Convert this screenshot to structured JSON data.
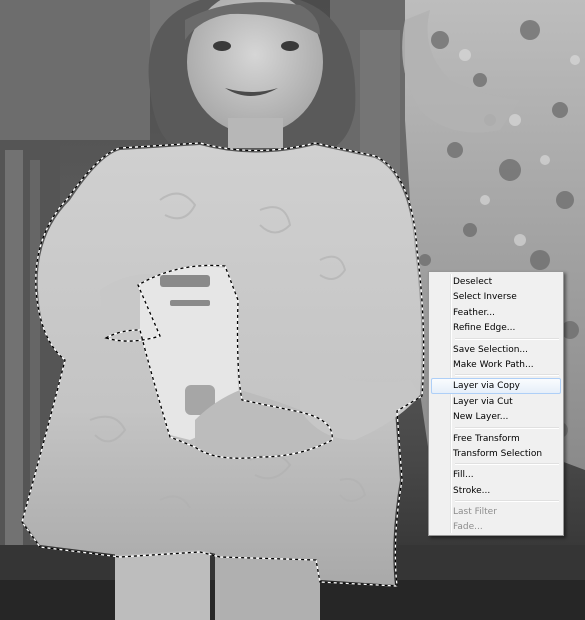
{
  "context_menu": {
    "groups": [
      [
        {
          "label": "Deselect",
          "enabled": true
        },
        {
          "label": "Select Inverse",
          "enabled": true
        },
        {
          "label": "Feather...",
          "enabled": true
        },
        {
          "label": "Refine Edge...",
          "enabled": true
        }
      ],
      [
        {
          "label": "Save Selection...",
          "enabled": true
        },
        {
          "label": "Make Work Path...",
          "enabled": true
        }
      ],
      [
        {
          "label": "Layer via Copy",
          "enabled": true,
          "highlighted": true
        },
        {
          "label": "Layer via Cut",
          "enabled": true
        },
        {
          "label": "New Layer...",
          "enabled": true
        }
      ],
      [
        {
          "label": "Free Transform",
          "enabled": true
        },
        {
          "label": "Transform Selection",
          "enabled": true
        }
      ],
      [
        {
          "label": "Fill...",
          "enabled": true
        },
        {
          "label": "Stroke...",
          "enabled": true
        }
      ],
      [
        {
          "label": "Last Filter",
          "enabled": false
        },
        {
          "label": "Fade...",
          "enabled": false
        }
      ]
    ]
  },
  "colors": {
    "menu_background": "#f0f0f0",
    "menu_highlight_border": "#aecff7",
    "disabled_text": "#8d8d8d"
  }
}
